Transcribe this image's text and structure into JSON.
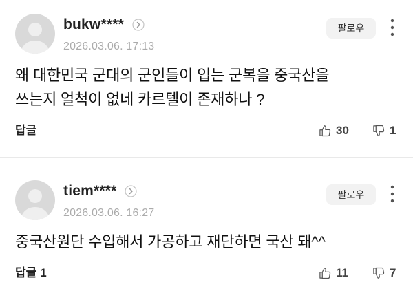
{
  "icons": {
    "avatar": "user-silhouette-icon",
    "profile_link": "chevron-right-circle-icon",
    "more": "more-vertical-icon",
    "like": "thumbs-up-icon",
    "dislike": "thumbs-down-icon"
  },
  "colors": {
    "text": "#111111",
    "meta_text": "#ababab",
    "follow_button_bg": "#f2f2f2",
    "avatar_bg": "#d9d9d9",
    "divider": "#e9e9e9"
  },
  "comments": [
    {
      "username": "bukw****",
      "date": "2026.03.06. 17:13",
      "follow_label": "팔로우",
      "text_lines": [
        "왜 대한민국 군대의 군인들이 입는 군복을 중국산을",
        "쓰는지 얼척이 없네 카르텔이 존재하나 ?"
      ],
      "reply_label": "답글",
      "likes": 30,
      "dislikes": 1
    },
    {
      "username": "tiem****",
      "date": "2026.03.06. 16:27",
      "follow_label": "팔로우",
      "text_lines": [
        "중국산원단 수입해서 가공하고 재단하면 국산 돼^^"
      ],
      "reply_label": "답글",
      "reply_count": 1,
      "likes": 11,
      "dislikes": 7
    }
  ]
}
